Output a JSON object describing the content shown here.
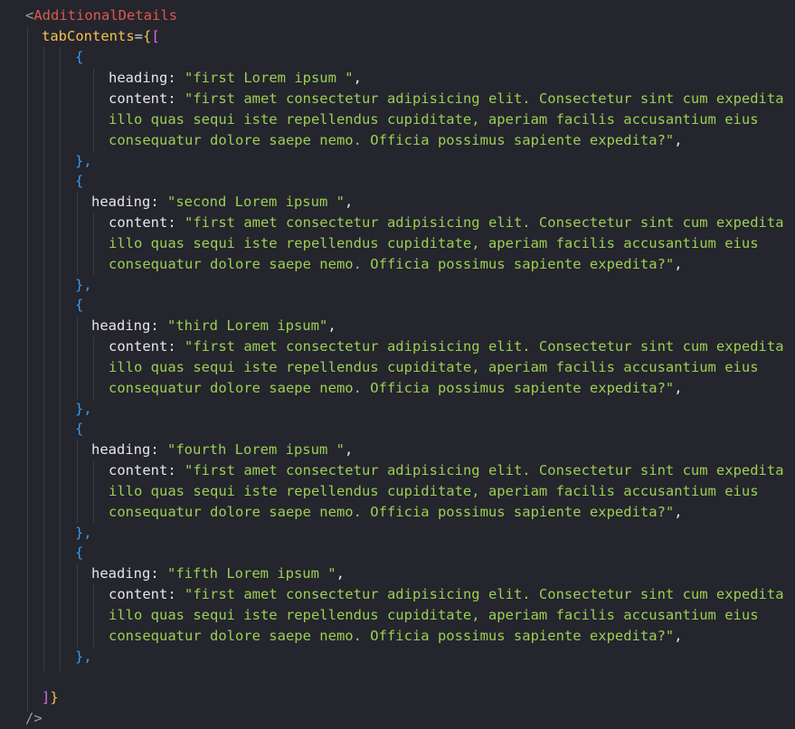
{
  "editor": {
    "tag_open_bracket": "<",
    "tag_name": "AdditionalDetails",
    "prop_name": "tabContents",
    "eq": "=",
    "open_curly": "{",
    "open_square": "[",
    "close_square": "]",
    "close_curly": "}",
    "self_close": "/>",
    "obj_open": "{",
    "obj_close": "},",
    "heading_key": "heading: ",
    "content_key": "content: ",
    "comma": ",",
    "items": [
      {
        "heading": "\"first Lorem ipsum \"",
        "content_line1": "\"first amet consectetur adipisicing elit. Consectetur sint cum expedita",
        "content_line2": "illo quas sequi iste repellendus cupiditate, aperiam facilis accusantium eius",
        "content_line3": "consequatur dolore saepe nemo. Officia possimus sapiente expedita?\""
      },
      {
        "heading": "\"second Lorem ipsum \"",
        "content_line1": "\"first amet consectetur adipisicing elit. Consectetur sint cum expedita",
        "content_line2": "illo quas sequi iste repellendus cupiditate, aperiam facilis accusantium eius",
        "content_line3": "consequatur dolore saepe nemo. Officia possimus sapiente expedita?\""
      },
      {
        "heading": "\"third Lorem ipsum\"",
        "content_line1": "\"first amet consectetur adipisicing elit. Consectetur sint cum expedita",
        "content_line2": "illo quas sequi iste repellendus cupiditate, aperiam facilis accusantium eius",
        "content_line3": "consequatur dolore saepe nemo. Officia possimus sapiente expedita?\""
      },
      {
        "heading": "\"fourth Lorem ipsum \"",
        "content_line1": "\"first amet consectetur adipisicing elit. Consectetur sint cum expedita",
        "content_line2": "illo quas sequi iste repellendus cupiditate, aperiam facilis accusantium eius",
        "content_line3": "consequatur dolore saepe nemo. Officia possimus sapiente expedita?\""
      },
      {
        "heading": "\"fifth Lorem ipsum \"",
        "content_line1": "\"first amet consectetur adipisicing elit. Consectetur sint cum expedita",
        "content_line2": "illo quas sequi iste repellendus cupiditate, aperiam facilis accusantium eius",
        "content_line3": "consequatur dolore saepe nemo. Officia possimus sapiente expedita?\""
      }
    ]
  },
  "colors": {
    "background": "#24252d",
    "tag_name": "#e0584d",
    "attribute": "#f5c150",
    "bracket_purple": "#d670d6",
    "bracket_blue": "#3a9cf0",
    "string": "#9ccf52",
    "text": "#e6e6e6"
  }
}
